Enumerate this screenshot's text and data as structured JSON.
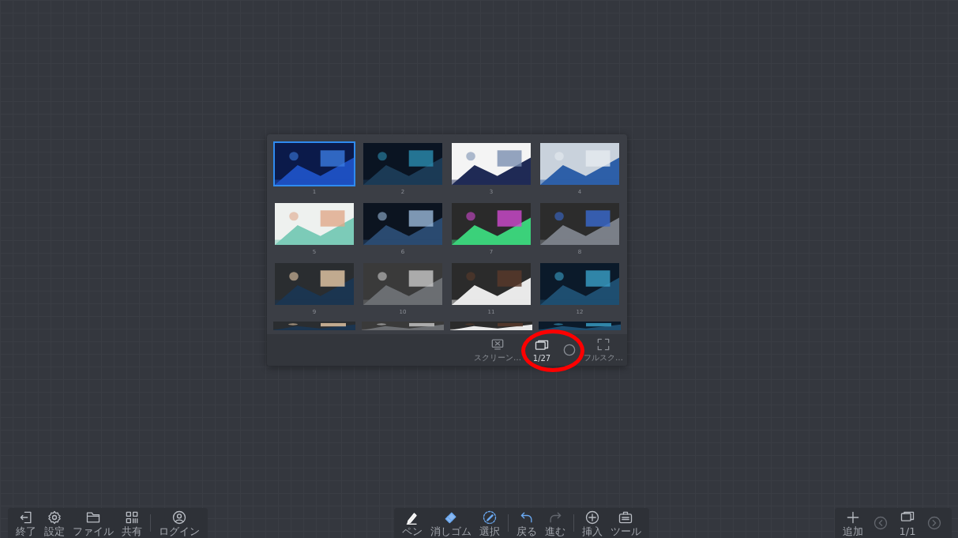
{
  "slides_panel": {
    "slides": [
      {
        "number": "1",
        "selected": true
      },
      {
        "number": "2",
        "selected": false
      },
      {
        "number": "3",
        "selected": false
      },
      {
        "number": "4",
        "selected": false
      },
      {
        "number": "5",
        "selected": false
      },
      {
        "number": "6",
        "selected": false
      },
      {
        "number": "7",
        "selected": false
      },
      {
        "number": "8",
        "selected": false
      },
      {
        "number": "9",
        "selected": false
      },
      {
        "number": "10",
        "selected": false
      },
      {
        "number": "11",
        "selected": false
      },
      {
        "number": "12",
        "selected": false
      }
    ],
    "controls": [
      {
        "kind": "screen",
        "label": "スクリーン…"
      },
      {
        "kind": "pages",
        "label": "1/27"
      },
      {
        "kind": "circle"
      },
      {
        "kind": "fullscreen",
        "label": "フルスク…"
      }
    ]
  },
  "annotation": {
    "kind": "circle"
  },
  "left_toolbar": [
    {
      "kind": "exit",
      "label": "終了"
    },
    {
      "kind": "settings",
      "label": "設定"
    },
    {
      "kind": "folder",
      "label": "ファイル"
    },
    {
      "kind": "share",
      "label": "共有"
    },
    {
      "kind": "divider"
    },
    {
      "kind": "user",
      "label": "ログイン"
    }
  ],
  "center_toolbar": [
    {
      "kind": "pen",
      "label": "ペン",
      "selected": true
    },
    {
      "kind": "eraser",
      "label": "消しゴム",
      "selected": false
    },
    {
      "kind": "select",
      "label": "選択",
      "selected": false
    },
    {
      "kind": "divider"
    },
    {
      "kind": "undo",
      "label": "戻る",
      "disabled": false
    },
    {
      "kind": "redo",
      "label": "進む",
      "disabled": true
    },
    {
      "kind": "divider"
    },
    {
      "kind": "insert",
      "label": "挿入"
    },
    {
      "kind": "tools",
      "label": "ツール"
    }
  ],
  "right_toolbar": [
    {
      "kind": "add",
      "label": "追加"
    },
    {
      "kind": "prev",
      "disabled": true
    },
    {
      "kind": "pages",
      "label": "1/1"
    },
    {
      "kind": "next",
      "disabled": true
    }
  ]
}
